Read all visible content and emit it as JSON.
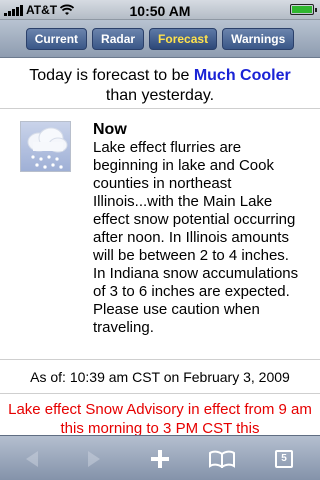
{
  "status": {
    "carrier": "AT&T",
    "time": "10:50 AM"
  },
  "nav": {
    "tabs": [
      {
        "label": "Current",
        "active": false
      },
      {
        "label": "Radar",
        "active": false
      },
      {
        "label": "Forecast",
        "active": true
      },
      {
        "label": "Warnings",
        "active": false
      }
    ]
  },
  "trend": {
    "prefix": "Today is forecast to be ",
    "highlight": "Much Cooler",
    "suffix": "than yesterday."
  },
  "now": {
    "icon": "snow-cloud-icon",
    "title": "Now",
    "body": "Lake effect flurries are beginning in lake and Cook counties in northeast Illinois...with the Main Lake effect snow potential occurring after noon. In Illinois amounts will be between 2 to 4 inches. In Indiana snow accumulations of 3 to 6 inches are expected. Please use caution when traveling."
  },
  "as_of": "As of: 10:39 am CST on February 3, 2009",
  "advisory": "Lake effect Snow Advisory in effect from 9 am this morning to 3 PM CST this",
  "toolbar": {
    "pages_count": "5",
    "icons": [
      "back-arrow-icon",
      "forward-arrow-icon",
      "plus-icon",
      "bookmarks-icon",
      "pages-icon"
    ]
  },
  "colors": {
    "highlight": "#1a23d6",
    "advisory": "#e60000",
    "active_tab": "#ffe24d"
  }
}
